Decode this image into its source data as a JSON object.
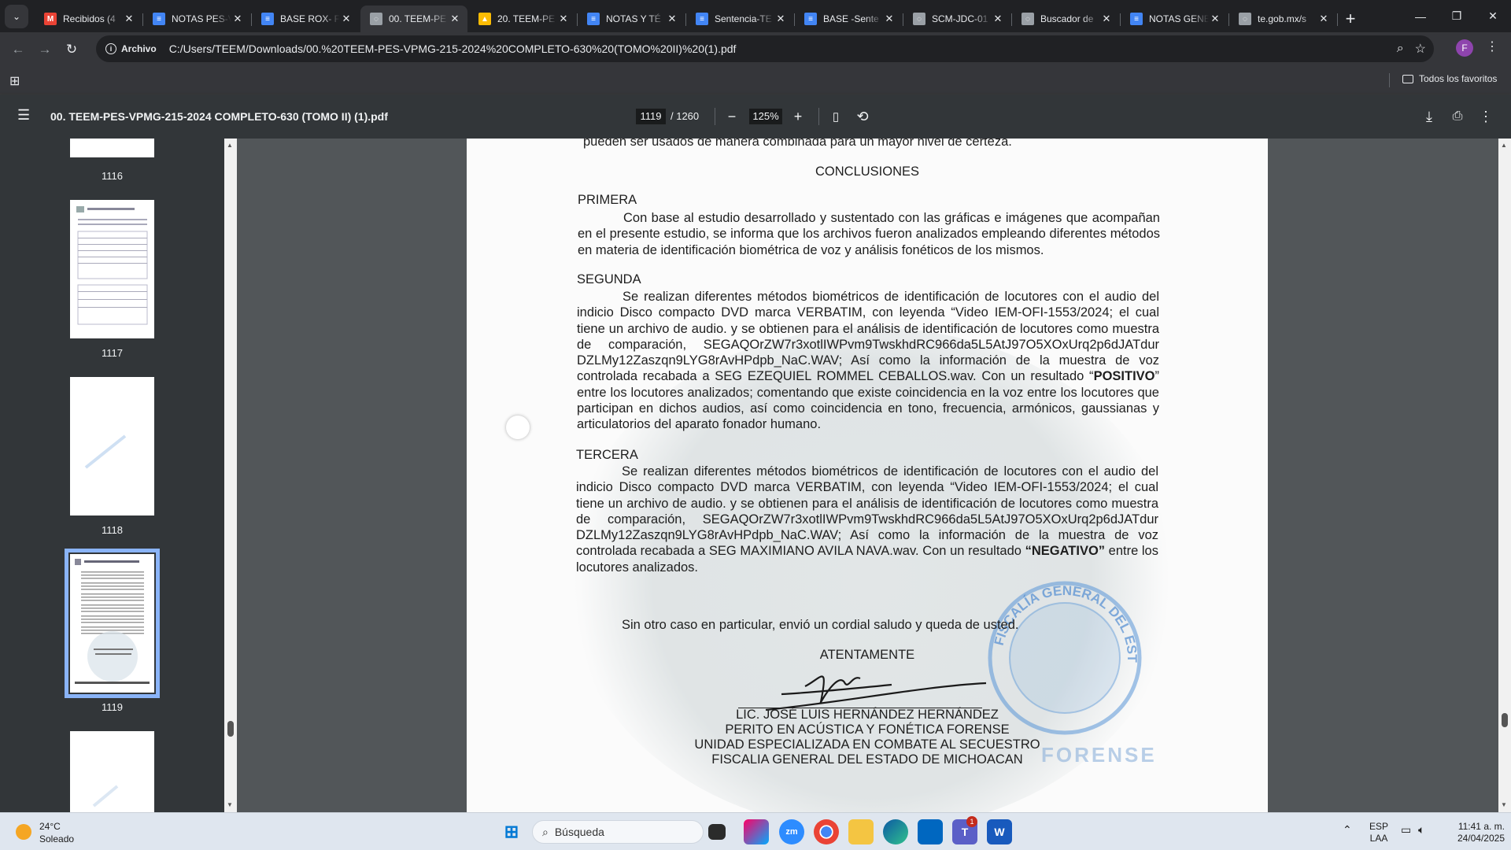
{
  "browser": {
    "tabs": [
      {
        "title": "Recibidos (4",
        "icon": "gmail-icon",
        "color": "#ea4335",
        "glyph": "M"
      },
      {
        "title": "NOTAS PES-V",
        "icon": "docs-icon",
        "color": "#4285f4",
        "glyph": "≡"
      },
      {
        "title": "BASE ROX- F",
        "icon": "docs-icon",
        "color": "#4285f4",
        "glyph": "≡"
      },
      {
        "title": "00. TEEM-PE",
        "icon": "globe-icon",
        "color": "#9aa0a6",
        "glyph": "◌"
      },
      {
        "title": "20. TEEM-PE",
        "icon": "drive-icon",
        "color": "#fbbc04",
        "glyph": "▲"
      },
      {
        "title": "NOTAS Y TÉ",
        "icon": "docs-icon",
        "color": "#4285f4",
        "glyph": "≡"
      },
      {
        "title": "Sentencia-TE",
        "icon": "docs-icon",
        "color": "#4285f4",
        "glyph": "≡"
      },
      {
        "title": "BASE -Sente",
        "icon": "docs-icon",
        "color": "#4285f4",
        "glyph": "≡"
      },
      {
        "title": "SCM-JDC-01",
        "icon": "globe-icon",
        "color": "#9aa0a6",
        "glyph": "◌"
      },
      {
        "title": "Buscador de",
        "icon": "globe-icon",
        "color": "#9aa0a6",
        "glyph": "◌"
      },
      {
        "title": "NOTAS GENE",
        "icon": "docs-icon",
        "color": "#4285f4",
        "glyph": "≡"
      },
      {
        "title": "te.gob.mx/s",
        "icon": "globe-icon",
        "color": "#9aa0a6",
        "glyph": "◌"
      }
    ],
    "active_tab": 3,
    "chip_label": "Archivo",
    "url": "C:/Users/TEEM/Downloads/00.%20TEEM-PES-VPMG-215-2024%20COMPLETO-630%20(TOMO%20II)%20(1).pdf",
    "profile_initial": "F",
    "bookmarks_all": "Todos los favoritos"
  },
  "pdf": {
    "title": "00. TEEM-PES-VPMG-215-2024 COMPLETO-630 (TOMO II) (1).pdf",
    "page_current": "1119",
    "page_total": "/  1260",
    "zoom": "125%",
    "thumbnails": [
      {
        "num": "1116"
      },
      {
        "num": "1117"
      },
      {
        "num": "1118"
      },
      {
        "num": "1119",
        "selected": true
      }
    ]
  },
  "document": {
    "top_line": "pueden ser usados de manera combinada para un mayor nivel de certeza.",
    "conclusions_title": "CONCLUSIONES",
    "primera_heading": "PRIMERA",
    "primera_text": "Con base al estudio desarrollado y sustentado con las gráficas e imágenes que acompañan en el presente estudio, se informa que los archivos fueron analizados empleando diferentes métodos en materia de identificación biométrica de voz y análisis fonéticos de los mismos.",
    "segunda_heading": "SEGUNDA",
    "segunda_text_1": "Se realizan diferentes métodos biométricos de identificación de locutores con el audio del indicio Disco compacto DVD marca VERBATIM, con leyenda “Video IEM-OFI-1553/2024; el cual tiene un archivo de audio. y se obtienen para el análisis de identificación de locutores como muestra de comparación, SEGAQOrZW7r3xotlIWPvm9TwskhdRC966da5L5AtJ97O5XOxUrq2p6dJATdur DZLMy12Zaszqn9LYG8rAvHPdpb_NaC.WAV; Así como la información de la muestra de voz controlada recabada a SEG EZEQUIEL ROMMEL CEBALLOS.wav. Con un resultado “",
    "segunda_result": "POSITIVO",
    "segunda_text_2": "” entre los locutores analizados; comentando que existe coincidencia en la voz entre los locutores que participan en dichos audios, así como coincidencia en tono, frecuencia, armónicos, gaussianas y articulatorios del aparato fonador humano.",
    "tercera_heading": "TERCERA",
    "tercera_text_1": "Se realizan diferentes métodos biométricos de identificación de locutores con el audio del indicio Disco compacto DVD marca VERBATIM, con leyenda “Video IEM-OFI-1553/2024; el cual tiene un archivo de audio. y se obtienen para el análisis de identificación de locutores como muestra de comparación, SEGAQOrZW7r3xotlIWPvm9TwskhdRC966da5L5AtJ97O5XOxUrq2p6dJATdur DZLMy12Zaszqn9LYG8rAvHPdpb_NaC.WAV; Así como la información de la muestra de voz controlada recabada a SEG MAXIMIANO AVILA NAVA.wav. Con un resultado ",
    "tercera_result": "“NEGATIVO”",
    "tercera_text_2": " entre los locutores analizados.",
    "closing": "Sin otro caso en particular, envió un cordial saludo y queda de usted.",
    "atentamente": "ATENTAMENTE",
    "signer_name": "LIC. JOSÉ LUIS HERNÁNDEZ HERNÁNDEZ",
    "signer_role": "PERITO EN ACÚSTICA Y FONÉTICA FORENSE",
    "signer_unit": "UNIDAD ESPECIALIZADA EN COMBATE AL SECUESTRO",
    "signer_org": "FISCALIA GENERAL DEL ESTADO DE MICHOACAN",
    "stamp_text": "FISCALÍA GENERAL DEL ESTADO",
    "watermark_text": "FORENSE"
  },
  "taskbar": {
    "weather_temp": "24°C",
    "weather_desc": "Soleado",
    "search_placeholder": "Búsqueda",
    "teams_badge": "1",
    "lang_top": "ESP",
    "lang_bottom": "LAA",
    "time": "11:41 a. m.",
    "date": "24/04/2025"
  }
}
